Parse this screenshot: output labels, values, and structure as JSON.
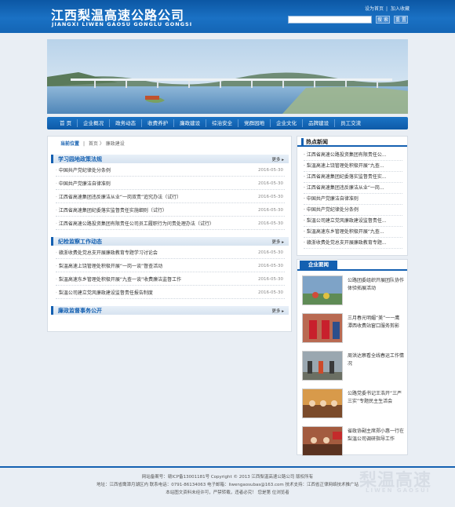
{
  "header": {
    "logo_cn": "江西梨温高速公路公司",
    "logo_en": "JIANGXI LIWEN GAOSU GONGLU GONGSI",
    "set_home": "设为首页",
    "add_fav": "加入收藏",
    "search_label": "搜 索",
    "reset_label": "重 置"
  },
  "nav": [
    "首 页",
    "企业概况",
    "政务动态",
    "收费养护",
    "廉政建设",
    "综治安全",
    "党群园地",
    "企业文化",
    "品牌建设",
    "员工交流"
  ],
  "breadcrumb": {
    "current": "当前位置",
    "home": "首页",
    "sep": "〉",
    "page": "廉政建设"
  },
  "more": "更多",
  "sections": [
    {
      "title": "学习园地政策法规",
      "items": [
        {
          "text": "中国共产党纪律处分条例",
          "date": "2016-05-30"
        },
        {
          "text": "中国共产党廉洁自律准则",
          "date": "2016-05-30"
        },
        {
          "text": "江西省高速集团违反廉洁从业“一岗双责”追究办法（试行）",
          "date": "2016-05-30"
        },
        {
          "text": "江西省高速集团纪委落实监督责任实施细则（试行）",
          "date": "2016-05-30"
        },
        {
          "text": "江西省高速公路投资集团有限责任公司员工履职行为问责处理办法（试行）",
          "date": "2016-05-30"
        }
      ]
    },
    {
      "title": "纪检监察工作动态",
      "items": [
        {
          "text": "赣浙收费处党总支开展廉政教育专题学习讨论会",
          "date": "2016-05-30"
        },
        {
          "text": "梨温高速上饶管理处积极开展“一岗一谈”督查活动",
          "date": "2016-05-30"
        },
        {
          "text": "梨温高速东乡管理处积极开展“九查一谈”收费廉洁监督工作",
          "date": "2016-05-30"
        },
        {
          "text": "梨温公司建立党风廉政建设监督责任报告制度",
          "date": "2016-05-30"
        }
      ]
    },
    {
      "title": "廉政监督事务公开",
      "items": []
    }
  ],
  "hot": {
    "title": "热点新闻",
    "items": [
      "江西省高速公路投资集团有限责任公...",
      "梨温高速上饶管理处积极开展“九查...",
      "江西省高速集团纪委落实监督责任实...",
      "江西省高速集团违反廉洁从业“一岗...",
      "中国共产党廉洁自律准则",
      "中国共产党纪律处分条例",
      "梨温公司建立党风廉政建设监督责任...",
      "梨温高速东乡管理处积极开展“九查...",
      "赣浙收费处党总支开展廉政教育专题..."
    ]
  },
  "qy": {
    "title": "企业要闻",
    "items": [
      "公路团委组织开展团队协作体验拓展活动",
      "三月春光明媚“美”一一鹰潭西收费站窗口服务剪影",
      "周洪达察看全线春运工作情况",
      "公路党委书记王浩开“三严三实”专题民主生活会",
      "省政协副主席郑小惠一行在梨温公司调研指导工作"
    ]
  },
  "footer": {
    "line1": "网站备案号：赣ICP备13001181号 Copyright © 2013 江西梨温高速公路公司 版权所有",
    "line2": "地址：江西省鹰潭月湖区内 联系电话：0791-86134063 电子邮箱：liwengaosubas@163.com 技术支持：江西省正律网络技术推广站",
    "line3": "本站图文资料未经许可，严禁转载，违者必究！  您是第  位浏览者",
    "brand_cn": "梨温高速",
    "brand_en": "LIWEN GAOSUI"
  }
}
